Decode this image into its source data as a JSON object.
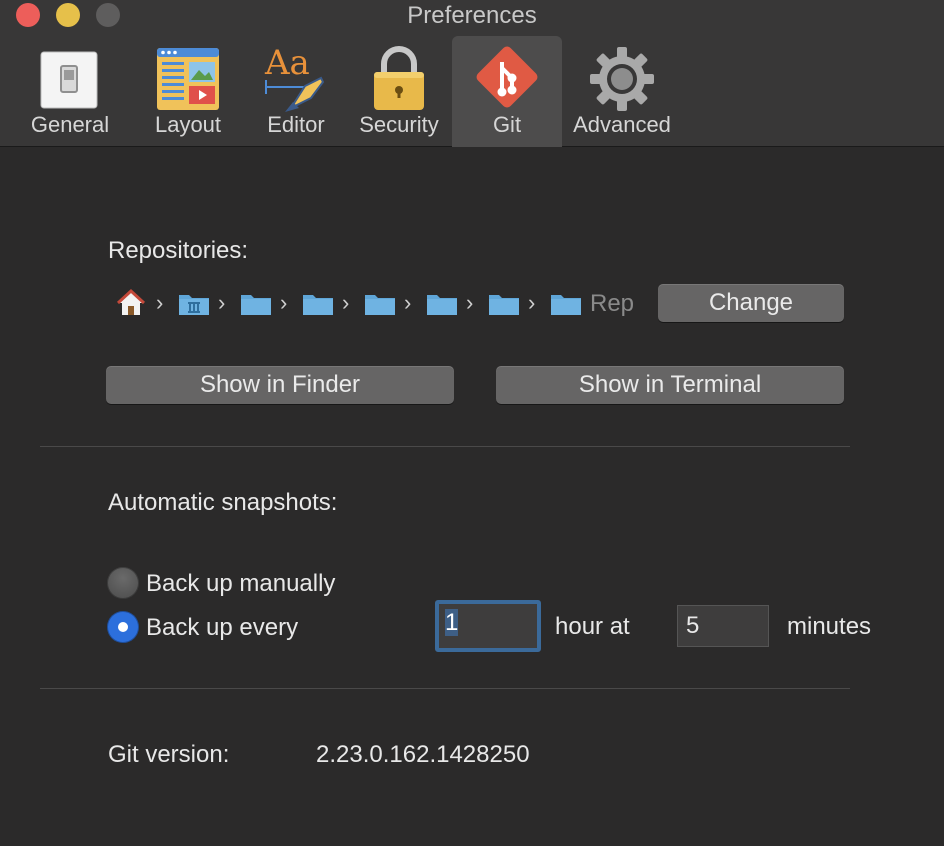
{
  "window": {
    "title": "Preferences"
  },
  "toolbar": {
    "tabs": [
      {
        "label": "General",
        "icon": "switch-icon",
        "active": false
      },
      {
        "label": "Layout",
        "icon": "layout-icon",
        "active": false
      },
      {
        "label": "Editor",
        "icon": "font-pen-icon",
        "active": false
      },
      {
        "label": "Security",
        "icon": "padlock-icon",
        "active": false
      },
      {
        "label": "Git",
        "icon": "git-icon",
        "active": true
      },
      {
        "label": "Advanced",
        "icon": "gear-icon",
        "active": false
      }
    ]
  },
  "repositories": {
    "label": "Repositories:",
    "path_tail": "Rep",
    "change_label": "Change",
    "show_finder_label": "Show in Finder",
    "show_terminal_label": "Show in Terminal"
  },
  "snapshots": {
    "label": "Automatic snapshots:",
    "manual_label": "Back up manually",
    "every_label": "Back up every",
    "selected": "every",
    "hours_value": "1",
    "hour_at_label": "hour at",
    "minutes_value": "5",
    "minutes_label": "minutes"
  },
  "git": {
    "version_label": "Git version:",
    "version_value": "2.23.0.162.1428250"
  },
  "colors": {
    "background": "#2b2a2a",
    "toolbar": "#383737",
    "accent": "#2c6fdc",
    "git_red": "#e05a44"
  }
}
